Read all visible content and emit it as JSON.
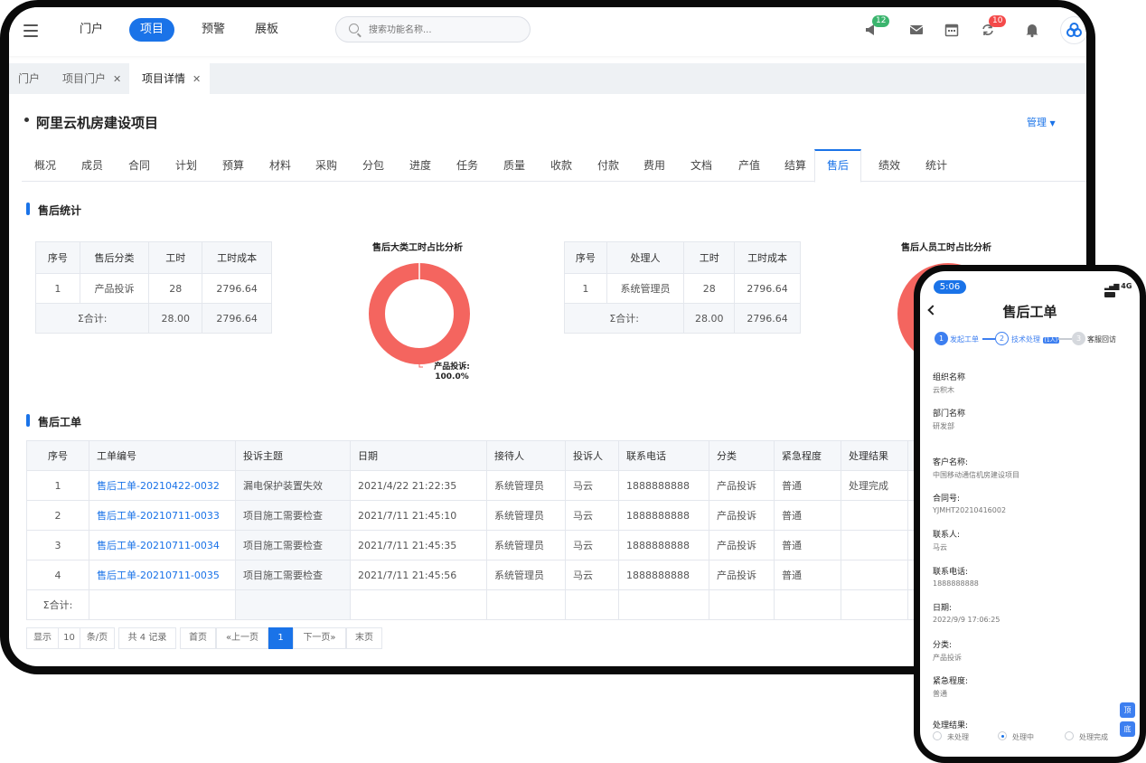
{
  "topbar": {
    "nav": [
      "门户",
      "项目",
      "预警",
      "展板"
    ],
    "search_placeholder": "搜索功能名称...",
    "badge_messages": "12",
    "badge_sync": "10"
  },
  "window_tabs": [
    {
      "label": "门户"
    },
    {
      "label": "项目门户"
    },
    {
      "label": "项目详情"
    }
  ],
  "project": {
    "title": "阿里云机房建设项目",
    "manage_label": "管理"
  },
  "subtabs": [
    "概况",
    "成员",
    "合同",
    "计划",
    "预算",
    "材料",
    "采购",
    "分包",
    "进度",
    "任务",
    "质量",
    "收款",
    "付款",
    "费用",
    "文档",
    "产值",
    "结算",
    "售后",
    "绩效",
    "统计"
  ],
  "stats_section": {
    "title": "售后统计",
    "category_table": {
      "headers": [
        "序号",
        "售后分类",
        "工时",
        "工时成本"
      ],
      "rows": [
        [
          "1",
          "产品投诉",
          "28",
          "2796.64"
        ]
      ],
      "total": {
        "label": "Σ合计:",
        "hours": "28.00",
        "cost": "2796.64"
      }
    },
    "category_donut": {
      "title": "售后大类工时占比分析",
      "label": "产品投诉:",
      "percent": "100.0%"
    },
    "person_table": {
      "headers": [
        "序号",
        "处理人",
        "工时",
        "工时成本"
      ],
      "rows": [
        [
          "1",
          "系统管理员",
          "28",
          "2796.64"
        ]
      ],
      "total": {
        "label": "Σ合计:",
        "hours": "28.00",
        "cost": "2796.64"
      }
    },
    "person_donut": {
      "title": "售后人员工时占比分析"
    }
  },
  "orders_section": {
    "title": "售后工单",
    "headers": [
      "序号",
      "工单编号",
      "投诉主题",
      "日期",
      "接待人",
      "投诉人",
      "联系电话",
      "分类",
      "紧急程度",
      "处理结果"
    ],
    "rows": [
      [
        "1",
        "售后工单-20210422-0032",
        "漏电保护装置失效",
        "2021/4/22 21:22:35",
        "系统管理员",
        "马云",
        "1888888888",
        "产品投诉",
        "普通",
        "处理完成"
      ],
      [
        "2",
        "售后工单-20210711-0033",
        "项目施工需要检查",
        "2021/7/11 21:45:10",
        "系统管理员",
        "马云",
        "1888888888",
        "产品投诉",
        "普通",
        ""
      ],
      [
        "3",
        "售后工单-20210711-0034",
        "项目施工需要检查",
        "2021/7/11 21:45:35",
        "系统管理员",
        "马云",
        "1888888888",
        "产品投诉",
        "普通",
        ""
      ],
      [
        "4",
        "售后工单-20210711-0035",
        "项目施工需要检查",
        "2021/7/11 21:45:56",
        "系统管理员",
        "马云",
        "1888888888",
        "产品投诉",
        "普通",
        ""
      ]
    ],
    "total_label": "Σ合计:"
  },
  "pager": {
    "show": "显示",
    "page_size": "10",
    "per_page": "条/页",
    "total": "共 4 记录",
    "first": "首页",
    "prev": "«上一页",
    "current": "1",
    "next": "下一页»",
    "last": "末页"
  },
  "phone": {
    "time": "5:06",
    "network": "4G",
    "title": "售后工单",
    "steps": [
      {
        "num": "1",
        "label": "发起工单"
      },
      {
        "num": "2",
        "label": "技术处理",
        "tag": "(1人)"
      },
      {
        "num": "3",
        "label": "客服回访"
      }
    ],
    "fields": [
      {
        "label": "组织名称",
        "value": "云积木"
      },
      {
        "label": "部门名称",
        "value": "研发部"
      },
      {
        "label": "客户名称:",
        "value": "中国移动通信机房建设项目"
      },
      {
        "label": "合同号:",
        "value": "YJMHT20210416002"
      },
      {
        "label": "联系人:",
        "value": "马云"
      },
      {
        "label": "联系电话:",
        "value": "1888888888"
      },
      {
        "label": "日期:",
        "value": "2022/9/9 17:06:25"
      },
      {
        "label": "分类:",
        "value": "产品投诉"
      },
      {
        "label": "紧急程度:",
        "value": "普通"
      }
    ],
    "result_label": "处理结果:",
    "result_options": [
      "未处理",
      "处理中",
      "处理完成"
    ],
    "fab_top": "顶",
    "fab_bottom": "底"
  },
  "colors": {
    "accent": "#1a73e8",
    "donut": "#f4655f",
    "badge_green": "#3bb56e",
    "badge_red": "#f44a4a"
  }
}
